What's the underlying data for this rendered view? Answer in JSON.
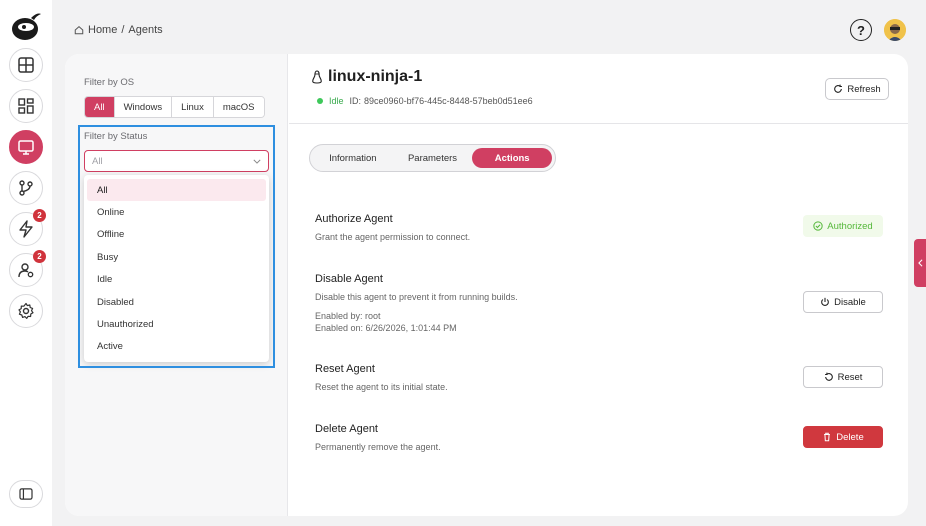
{
  "breadcrumb": {
    "home": "Home",
    "separator": "/",
    "current": "Agents"
  },
  "header": {
    "help_icon": "help-circle-icon",
    "avatar": "user-avatar"
  },
  "rail": {
    "items": [
      {
        "name": "dashboard",
        "icon": "layout-icon",
        "badge": ""
      },
      {
        "name": "apps",
        "icon": "grid-icon",
        "badge": ""
      },
      {
        "name": "agents",
        "icon": "monitor-icon",
        "badge": "",
        "active": true
      },
      {
        "name": "pipelines",
        "icon": "branch-icon",
        "badge": ""
      },
      {
        "name": "events",
        "icon": "lightning-icon",
        "badge": "2"
      },
      {
        "name": "users",
        "icon": "user-settings-icon",
        "badge": "2"
      },
      {
        "name": "settings",
        "icon": "gear-icon",
        "badge": ""
      }
    ]
  },
  "filters": {
    "os_label": "Filter by OS",
    "os_options": [
      "All",
      "Windows",
      "Linux",
      "macOS"
    ],
    "os_selected": "All",
    "status_label": "Filter by Status",
    "status_placeholder": "All",
    "status_options": [
      "All",
      "Online",
      "Offline",
      "Busy",
      "Idle",
      "Disabled",
      "Unauthorized",
      "Active"
    ],
    "status_selected": "All"
  },
  "agent": {
    "name": "linux-ninja-1",
    "status": "Idle",
    "id_label": "ID:",
    "id": "89ce0960-bf76-445c-8448-57beb0d51ee6",
    "refresh_label": "Refresh"
  },
  "tabs": [
    "Information",
    "Parameters",
    "Actions"
  ],
  "active_tab": "Actions",
  "actions": {
    "authorize": {
      "title": "Authorize Agent",
      "desc": "Grant the agent permission to connect.",
      "state": "Authorized"
    },
    "disable": {
      "title": "Disable Agent",
      "desc": "Disable this agent to prevent it from running builds.",
      "enabled_by": "Enabled by: root",
      "enabled_on": "Enabled on: 6/26/2026, 1:01:44 PM",
      "button": "Disable"
    },
    "reset": {
      "title": "Reset Agent",
      "desc": "Reset the agent to its initial state.",
      "button": "Reset"
    },
    "delete": {
      "title": "Delete Agent",
      "desc": "Permanently remove the agent.",
      "button": "Delete"
    }
  },
  "colors": {
    "accent": "#d03f62",
    "success": "#3aaa4e",
    "danger": "#d0383e",
    "highlight": "#2e8fe0"
  }
}
